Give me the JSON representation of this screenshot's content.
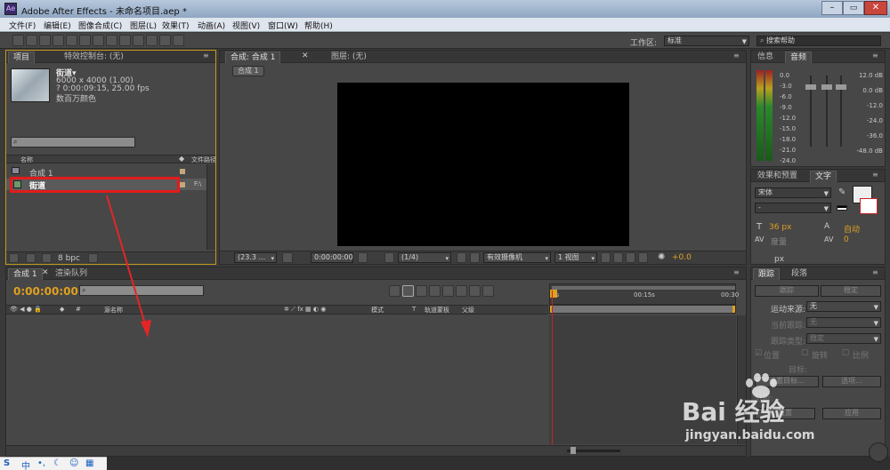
{
  "titlebar": {
    "title": "Adobe After Effects - 未命名项目.aep *"
  },
  "menubar": {
    "items": [
      "文件(F)",
      "编辑(E)",
      "图像合成(C)",
      "图层(L)",
      "效果(T)",
      "动画(A)",
      "视图(V)",
      "窗口(W)",
      "帮助(H)"
    ]
  },
  "toolbar": {
    "workspace_label": "工作区:",
    "workspace_value": "标准",
    "search_placeholder": "搜索帮助"
  },
  "project_panel": {
    "tab_project": "项目",
    "tab_effects": "特效控制台: (无)",
    "item_name": "街道▾",
    "item_size": "6000 x 4000 (1.00)",
    "item_duration": "? 0:00:09:15, 25.00 fps",
    "item_color": "数百万颜色",
    "col_name": "名称",
    "col_path": "文件路径",
    "rows": [
      {
        "name": "合成 1",
        "path": ""
      },
      {
        "name": "街道",
        "path": "F:\\"
      }
    ],
    "bpc": "8 bpc"
  },
  "comp_panel": {
    "tab_comp": "合成: 合成 1",
    "tab_layer": "图层: (无)",
    "breadcrumb": "合成 1",
    "zoom": "(23.3 ...",
    "timecode": "0:00:00:00",
    "resolution": "(1/4)",
    "camera": "有效摄像机",
    "views": "1 视图",
    "exposure": "+0.0"
  },
  "info_panel": {
    "tab_info": "信息",
    "tab_audio": "音频",
    "left_scale": [
      "0.0",
      "-3.0",
      "-6.0",
      "-9.0",
      "-12.0",
      "-15.0",
      "-18.0",
      "-21.0",
      "-24.0"
    ],
    "right_scale": [
      "12.0 dB",
      "0.0 dB",
      "-12.0",
      "-24.0",
      "-36.0",
      "-48.0 dB"
    ]
  },
  "char_panel": {
    "tab_effects": "效果和预置",
    "tab_text": "文字",
    "font": "宋体",
    "style": "-",
    "size": "36 px",
    "leading": "自动",
    "kerning": "度量",
    "tracking": "0",
    "unit": "px"
  },
  "timeline": {
    "tab_comp": "合成 1",
    "tab_render": "渲染队列",
    "timecode": "0:00:00:00",
    "col_num": "#",
    "col_source": "源名称",
    "col_mode": "模式",
    "col_t": "T",
    "col_trkmat": "轨道蒙板",
    "col_parent": "父级",
    "ruler": [
      "0s",
      "00:15s",
      "00:30"
    ]
  },
  "tracker_panel": {
    "tab_tracker": "跟踪",
    "tab_paragraph": "段落",
    "btn_track_camera": "跟踪",
    "btn_stabilize": "稳定",
    "motion_source_label": "运动来源:",
    "motion_source_value": "无",
    "current_track_label": "当前跟踪:",
    "current_track_value": "无",
    "track_type_label": "跟踪类型:",
    "track_type_value": "稳定",
    "cb_position": "位置",
    "cb_rotation": "旋转",
    "cb_scale": "比例",
    "target_label": "目标:",
    "btn_edit_target": "设置目标...",
    "btn_options": "选项...",
    "analyze_label": "分析:",
    "btn_reset": "重置",
    "btn_apply": "应用"
  },
  "watermark": {
    "brand": "Bai 经验",
    "url": "jingyan.baidu.com"
  },
  "taskbar": {
    "ime": "中"
  }
}
